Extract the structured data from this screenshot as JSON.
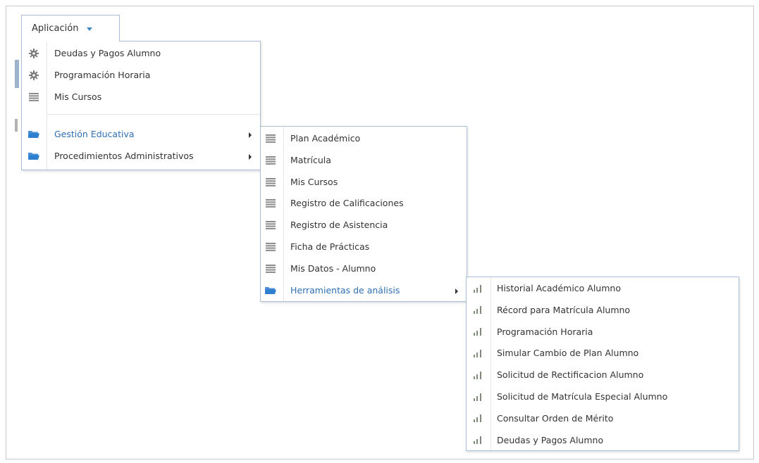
{
  "app_menu": {
    "label": "Aplicación"
  },
  "menu_main": {
    "items": [
      {
        "label": "Deudas y Pagos Alumno",
        "icon": "gear-icon"
      },
      {
        "label": "Programación Horaria",
        "icon": "gear-icon"
      },
      {
        "label": "Mis Cursos",
        "icon": "list-icon"
      },
      {
        "label": "Gestión Educativa",
        "icon": "folder-icon",
        "submenu": true,
        "active": true
      },
      {
        "label": "Procedimientos Administrativos",
        "icon": "folder-icon",
        "submenu": true
      }
    ]
  },
  "menu_gestion": {
    "items": [
      {
        "label": "Plan Académico",
        "icon": "list-icon"
      },
      {
        "label": "Matrícula",
        "icon": "list-icon"
      },
      {
        "label": "Mis Cursos",
        "icon": "list-icon"
      },
      {
        "label": "Registro de Calificaciones",
        "icon": "list-icon"
      },
      {
        "label": "Registro de Asistencia",
        "icon": "list-icon"
      },
      {
        "label": "Ficha de Prácticas",
        "icon": "list-icon"
      },
      {
        "label": "Mis Datos - Alumno",
        "icon": "list-icon"
      },
      {
        "label": "Herramientas de análisis",
        "icon": "folder-icon",
        "submenu": true,
        "active": true
      }
    ]
  },
  "menu_herramientas": {
    "items": [
      {
        "label": "Historial Académico Alumno",
        "icon": "bar-chart-icon"
      },
      {
        "label": "Récord para Matrícula Alumno",
        "icon": "bar-chart-icon"
      },
      {
        "label": "Programación Horaria",
        "icon": "bar-chart-icon"
      },
      {
        "label": "Simular Cambio de Plan Alumno",
        "icon": "bar-chart-icon"
      },
      {
        "label": "Solicitud de Rectificacion Alumno",
        "icon": "bar-chart-icon"
      },
      {
        "label": "Solicitud de Matrícula Especial Alumno",
        "icon": "bar-chart-icon"
      },
      {
        "label": "Consultar Orden de Mérito",
        "icon": "bar-chart-icon"
      },
      {
        "label": "Deudas y Pagos Alumno",
        "icon": "bar-chart-icon"
      }
    ]
  },
  "colors": {
    "accent": "#2f6fb3",
    "border": "#a9bfd6",
    "text": "#333333",
    "icon_gray": "#7a7a7a",
    "folder_blue": "#2f7fd0"
  }
}
